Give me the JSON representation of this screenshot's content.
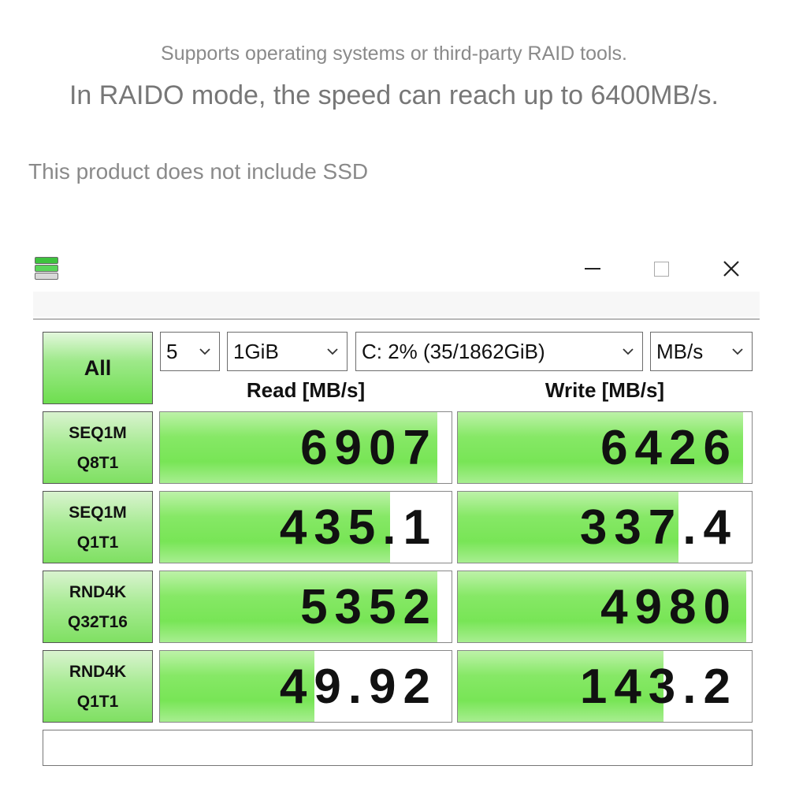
{
  "captions": {
    "line1": "Supports operating systems or third-party RAID tools.",
    "line2": "In RAIDO mode, the speed can reach up to 6400MB/s.",
    "line3": "This product does not include SSD"
  },
  "window": {
    "icons": {
      "app": "disk-benchmark-icon",
      "minimize": "minimize-icon",
      "maximize": "maximize-icon",
      "close": "close-icon"
    }
  },
  "toolbar": {
    "all_label": "All",
    "count": "5",
    "size": "1GiB",
    "drive": "C: 2% (35/1862GiB)",
    "unit": "MB/s"
  },
  "headers": {
    "read": "Read [MB/s]",
    "write": "Write [MB/s]"
  },
  "tests": [
    {
      "line1": "SEQ1M",
      "line2": "Q8T1",
      "read": "6907",
      "write": "6426",
      "read_fill": 0.95,
      "write_fill": 0.97
    },
    {
      "line1": "SEQ1M",
      "line2": "Q1T1",
      "read": "435.1",
      "write": "337.4",
      "read_fill": 0.79,
      "write_fill": 0.75
    },
    {
      "line1": "RND4K",
      "line2": "Q32T16",
      "read": "5352",
      "write": "4980",
      "read_fill": 0.95,
      "write_fill": 0.98
    },
    {
      "line1": "RND4K",
      "line2": "Q1T1",
      "read": "49.92",
      "write": "143.2",
      "read_fill": 0.53,
      "write_fill": 0.7
    }
  ],
  "colors": {
    "accent_green": "#78e556",
    "border": "#888888"
  }
}
